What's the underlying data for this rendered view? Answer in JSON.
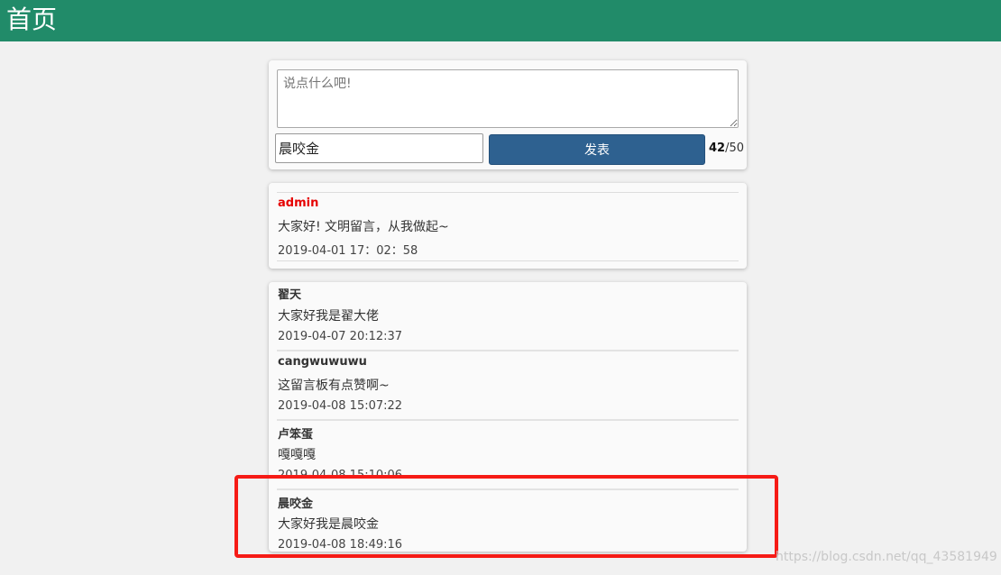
{
  "header": {
    "title": "首页",
    "background": "#218b69"
  },
  "compose": {
    "placeholder": "说点什么吧!",
    "name_value": "晨咬金",
    "submit_label": "发表",
    "count_current": "42",
    "count_max": "/50",
    "button_color": "#2e6190"
  },
  "pinned": {
    "author": "admin",
    "content": "大家好! 文明留言，从我做起~",
    "time": "2019-04-01 17：02：58",
    "author_color": "#e60000"
  },
  "messages": [
    {
      "author": "翟天",
      "content": "大家好我是翟大佬",
      "time": "2019-04-07 20:12:37"
    },
    {
      "author": "cangwuwuwu",
      "content": "这留言板有点赞啊~",
      "time": "2019-04-08 15:07:22"
    },
    {
      "author": "卢笨蛋",
      "content": "嘎嘎嘎",
      "time": "2019-04-08 15:10:06"
    },
    {
      "author": "晨咬金",
      "content": "大家好我是晨咬金",
      "time": "2019-04-08 18:49:16"
    }
  ],
  "annotation": {
    "highlight_color": "#f61b16"
  },
  "watermark": "https://blog.csdn.net/qq_43581949"
}
